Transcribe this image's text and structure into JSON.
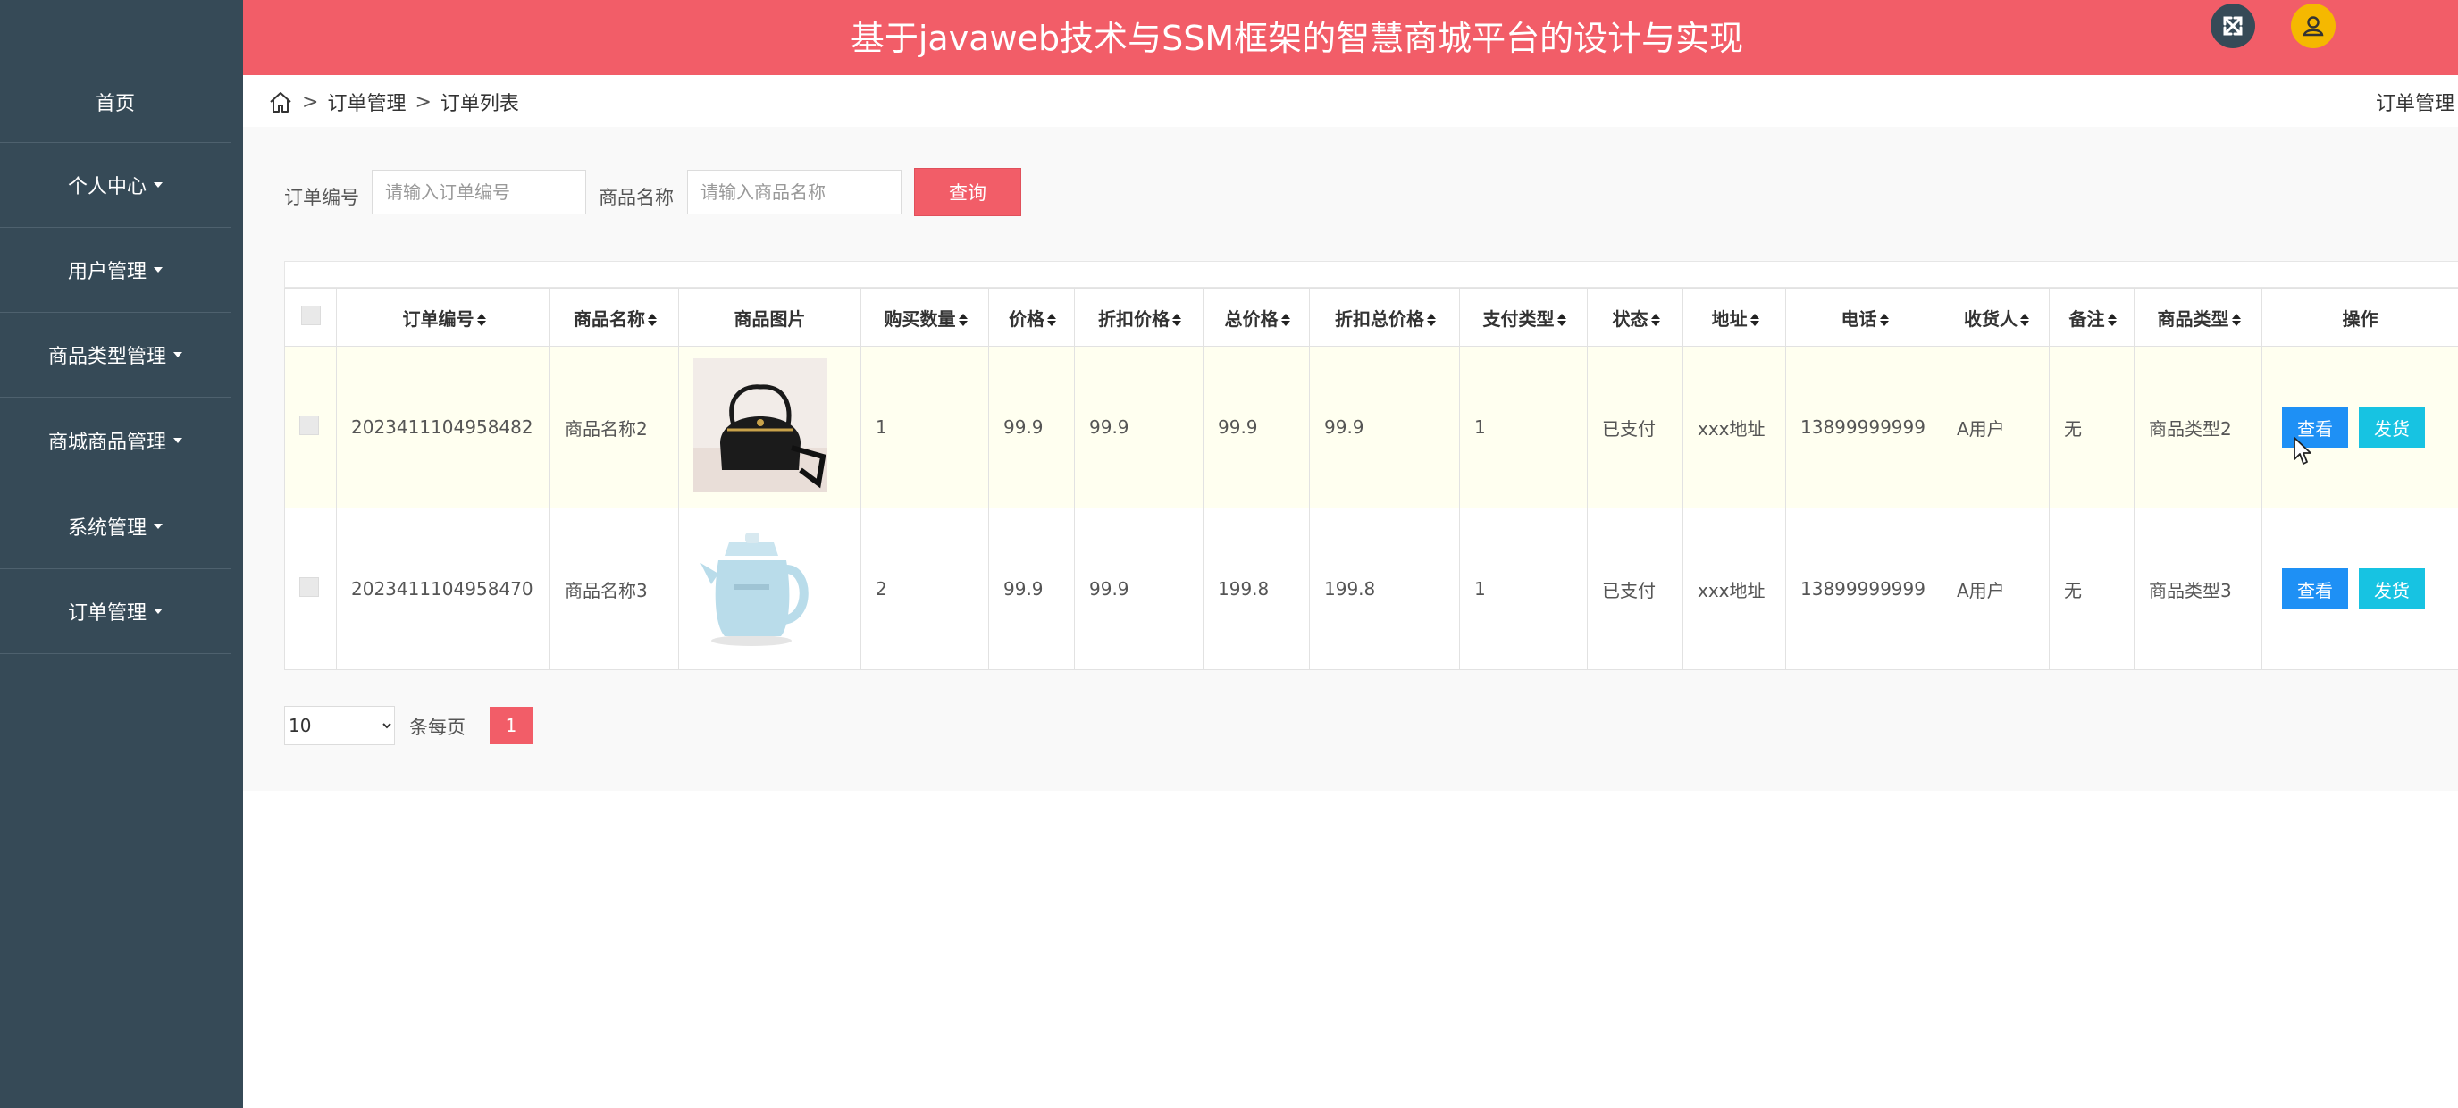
{
  "header": {
    "title": "基于javaweb技术与SSM框架的智慧商城平台的设计与实现"
  },
  "sidebar": {
    "items": [
      {
        "label": "首页",
        "dropdown": false
      },
      {
        "label": "个人中心",
        "dropdown": true
      },
      {
        "label": "用户管理",
        "dropdown": true
      },
      {
        "label": "商品类型管理",
        "dropdown": true
      },
      {
        "label": "商城商品管理",
        "dropdown": true
      },
      {
        "label": "系统管理",
        "dropdown": true
      },
      {
        "label": "订单管理",
        "dropdown": true
      }
    ]
  },
  "breadcrumb": {
    "sep": ">",
    "level1": "订单管理",
    "level2": "订单列表",
    "right": "订单管理"
  },
  "search": {
    "order_no_label": "订单编号",
    "order_no_placeholder": "请输入订单编号",
    "product_name_label": "商品名称",
    "product_name_placeholder": "请输入商品名称",
    "query_button": "查询"
  },
  "table": {
    "headers": [
      "订单编号",
      "商品名称",
      "商品图片",
      "购买数量",
      "价格",
      "折扣价格",
      "总价格",
      "折扣总价格",
      "支付类型",
      "状态",
      "地址",
      "电话",
      "收货人",
      "备注",
      "商品类型",
      "操作"
    ],
    "rows": [
      {
        "order_no": "2023411104958482",
        "product_name": "商品名称2",
        "image": "black-handbag",
        "quantity": "1",
        "price": "99.9",
        "discount_price": "99.9",
        "total_price": "99.9",
        "discount_total": "99.9",
        "pay_type": "1",
        "status": "已支付",
        "address": "xxx地址",
        "phone": "13899999999",
        "receiver": "A用户",
        "remark": "无",
        "product_type": "商品类型2"
      },
      {
        "order_no": "2023411104958470",
        "product_name": "商品名称3",
        "image": "blue-kettle",
        "quantity": "2",
        "price": "99.9",
        "discount_price": "99.9",
        "total_price": "199.8",
        "discount_total": "199.8",
        "pay_type": "1",
        "status": "已支付",
        "address": "xxx地址",
        "phone": "13899999999",
        "receiver": "A用户",
        "remark": "无",
        "product_type": "商品类型3"
      }
    ],
    "actions": {
      "view": "查看",
      "ship": "发货"
    }
  },
  "pagination": {
    "page_size": "10",
    "per_page_label": "条每页",
    "current_page": "1"
  },
  "colors": {
    "brand": "#f25d68",
    "sidebar": "#364a57",
    "view": "#1e90f5",
    "ship": "#17c3e2",
    "highlight_row": "#fffff0"
  },
  "icons": {
    "fullscreen": "expand-icon",
    "user": "user-icon",
    "home": "home-icon"
  }
}
